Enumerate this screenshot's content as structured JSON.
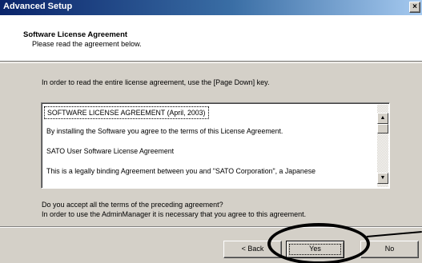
{
  "window": {
    "title": "Advanced Setup",
    "close_glyph": "×"
  },
  "header": {
    "title": "Software License Agreement",
    "subtitle": "Please read the agreement below."
  },
  "instruction": "In order to read the entire license agreement, use the [Page Down] key.",
  "license": {
    "lines": [
      "SOFTWARE LICENSE AGREEMENT (April, 2003)",
      "By installing the Software you agree to the terms of this License Agreement.",
      "SATO User Software License Agreement",
      "This is a legally binding Agreement between you and \"SATO Corporation\", a Japanese"
    ],
    "scroll_up_glyph": "▲",
    "scroll_down_glyph": "▼"
  },
  "question": {
    "line1": "Do you accept all the terms of the preceding agreement?",
    "line2": "In order to use the AdminManager it is necessary that you agree to this agreement."
  },
  "buttons": {
    "back": "< Back",
    "yes": "Yes",
    "no": "No"
  },
  "colors": {
    "titlebar_start": "#0a246a",
    "titlebar_end": "#a6caf0",
    "dialog_face": "#d4d0c8"
  }
}
